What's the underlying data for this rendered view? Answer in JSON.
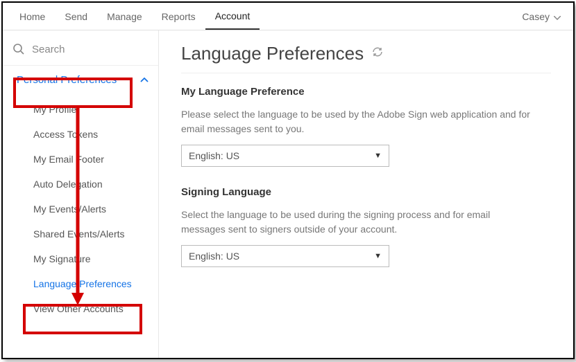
{
  "topnav": {
    "items": [
      "Home",
      "Send",
      "Manage",
      "Reports",
      "Account"
    ],
    "active_index": 4
  },
  "user": {
    "name": "Casey"
  },
  "sidebar": {
    "search_placeholder": "Search",
    "section_label": "Personal Preferences",
    "items": [
      "My Profile",
      "Access Tokens",
      "My Email Footer",
      "Auto Delegation",
      "My Events/Alerts",
      "Shared Events/Alerts",
      "My Signature",
      "Language Preferences",
      "View Other Accounts"
    ],
    "selected_index": 7
  },
  "main": {
    "page_title": "Language Preferences",
    "section1": {
      "title": "My Language Preference",
      "desc": "Please select the language to be used by the Adobe Sign web application and for email messages sent to you.",
      "select_value": "English: US"
    },
    "section2": {
      "title": "Signing Language",
      "desc": "Select the language to be used during the signing process and for email messages sent to signers outside of your account.",
      "select_value": "English: US"
    }
  }
}
